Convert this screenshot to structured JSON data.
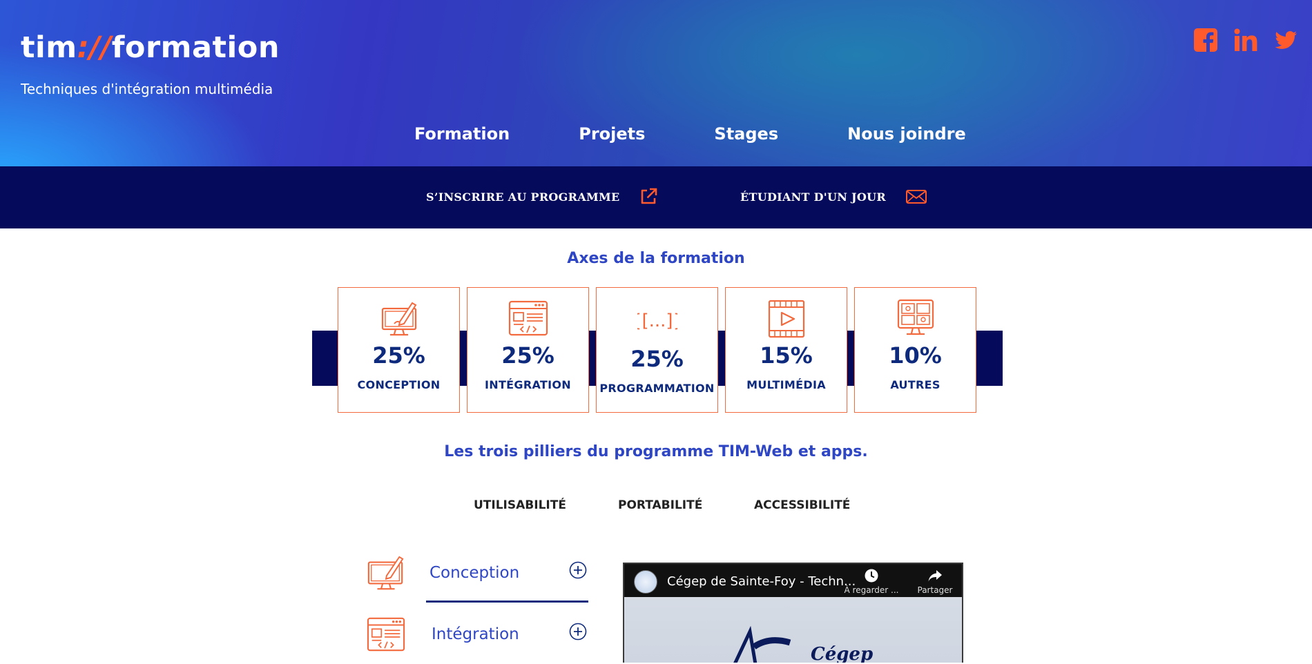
{
  "header": {
    "logo_left": "tim",
    "logo_slash": "://",
    "logo_right": "formation",
    "tagline": "Techniques d'intégration multimédia",
    "social": [
      "facebook-icon",
      "linkedin-icon",
      "twitter-icon"
    ],
    "nav": [
      "Formation",
      "Projets",
      "Stages",
      "Nous joindre"
    ]
  },
  "cta": {
    "register": "S’INSCRIRE AU PROGRAMME",
    "student_day": "ÉTUDIANT D'UN JOUR"
  },
  "axes": {
    "title": "Axes de la formation",
    "items": [
      {
        "value": "25%",
        "label": "CONCEPTION",
        "icon": "monitor-pencil-icon"
      },
      {
        "value": "25%",
        "label": "INTÉGRATION",
        "icon": "browser-code-icon"
      },
      {
        "value": "25%",
        "label": "PROGRAMMATION",
        "icon": "brackets-code-icon"
      },
      {
        "value": "15%",
        "label": "MULTIMÉDIA",
        "icon": "film-play-icon"
      },
      {
        "value": "10%",
        "label": "AUTRES",
        "icon": "monitor-grid-icon"
      }
    ]
  },
  "pillars": {
    "title": "Les trois pilliers du programme TIM-Web et apps.",
    "items": [
      "UTILISABILITÉ",
      "PORTABILITÉ",
      "ACCESSIBILITÉ"
    ]
  },
  "accordion": [
    {
      "title": "Conception",
      "icon": "monitor-pencil-icon"
    },
    {
      "title": "Intégration",
      "icon": "browser-code-icon"
    }
  ],
  "video": {
    "title": "Cégep de Sainte-Foy - Techn...",
    "watch_later": "À regarder ...",
    "share": "Partager",
    "brand_text": "Cégep"
  },
  "colors": {
    "accent": "#f26a3d",
    "navy": "#050a5a",
    "heading_blue": "#2f46c4",
    "dark_blue_text": "#0e2a7d"
  }
}
